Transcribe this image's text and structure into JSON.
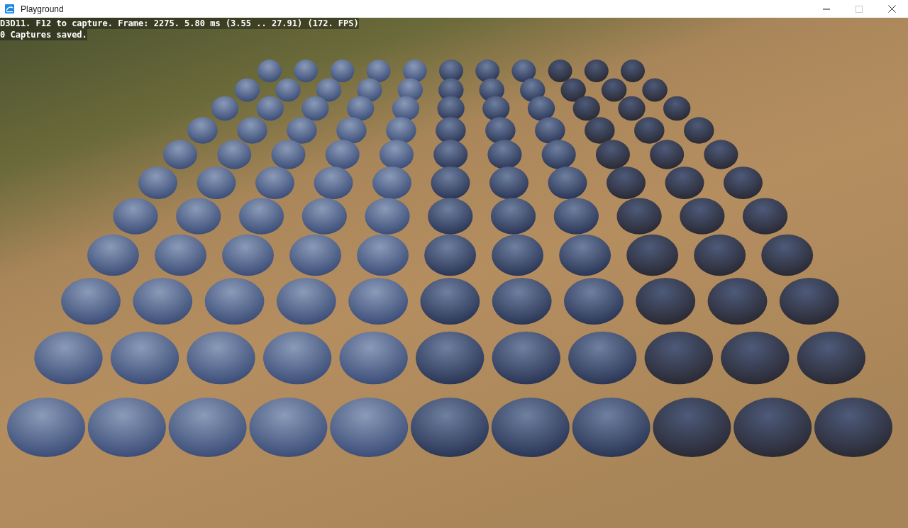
{
  "window": {
    "title": "Playground"
  },
  "window_controls": [
    {
      "kind": "minimize",
      "disabled": false
    },
    {
      "kind": "maximize",
      "disabled": true
    },
    {
      "kind": "close",
      "disabled": false
    }
  ],
  "overlay": {
    "lines": [
      "D3D11. F12 to capture. Frame: 2275. 5.80 ms (3.55 .. 27.91) (172. FPS)",
      "0 Captures saved."
    ]
  }
}
